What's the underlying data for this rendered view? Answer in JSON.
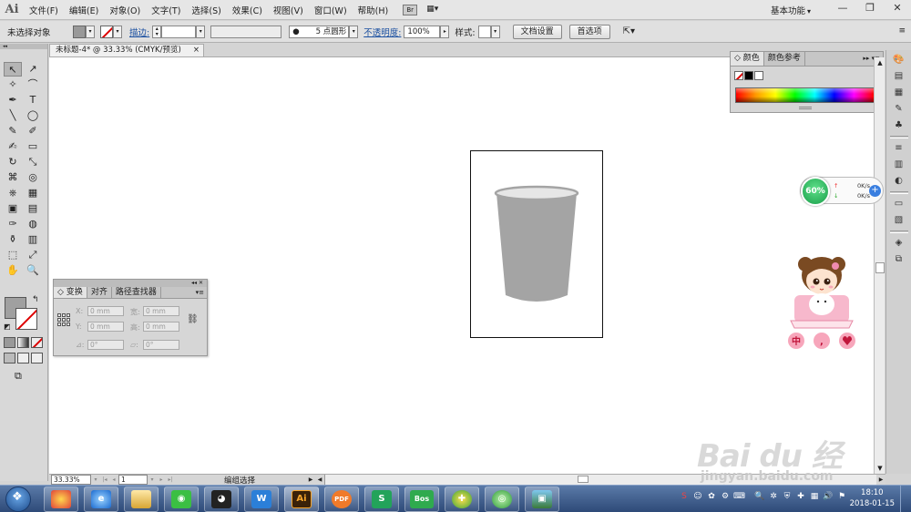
{
  "app": {
    "logo": "Ai",
    "workspace": "基本功能",
    "window_controls": [
      "—",
      "❐",
      "✕"
    ]
  },
  "menu": [
    "文件(F)",
    "编辑(E)",
    "对象(O)",
    "文字(T)",
    "选择(S)",
    "效果(C)",
    "视图(V)",
    "窗口(W)",
    "帮助(H)"
  ],
  "bridge_label": "Br",
  "control": {
    "selection": "未选择对象",
    "stroke_label": "描边:",
    "brush": "5 点圆形",
    "opacity_label": "不透明度:",
    "opacity_value": "100%",
    "style_label": "样式:",
    "doc_setup": "文档设置",
    "prefs": "首选项"
  },
  "document": {
    "tab_title": "未标题-4* @ 33.33% (CMYK/预览)",
    "close": "×"
  },
  "tools": [
    "↖",
    "↗",
    "✧",
    "⌒",
    "✒",
    "T",
    "╲",
    "◯",
    "✎",
    "✐",
    "✍",
    "▭",
    "↻",
    "⤡",
    "⌘",
    "◎",
    "⎈",
    "▦",
    "▣",
    "▤",
    "✑",
    "◍",
    "⚱",
    "▥",
    "⬚",
    "⤢",
    "✋",
    "🔍"
  ],
  "transform_panel": {
    "tabs": [
      "变换",
      "对齐",
      "路径查找器"
    ],
    "x_label": "X:",
    "x_value": "0 mm",
    "w_label": "宽:",
    "w_value": "0 mm",
    "y_label": "Y:",
    "y_value": "0 mm",
    "h_label": "高:",
    "h_value": "0 mm",
    "rotate_label": "⊿:",
    "rotate_value": "0°",
    "shear_label": "▱:",
    "shear_value": "0°"
  },
  "color_panel": {
    "tabs": [
      "颜色",
      "颜色参考"
    ],
    "swatches": [
      "none",
      "#000000",
      "#ffffff"
    ]
  },
  "cup": {
    "body_color": "#a4a4a4",
    "rim_color": "#e6e6e6"
  },
  "net_widget": {
    "percent": "60%",
    "up": "0K/s",
    "down": "0K/s",
    "up_arrow": "↑",
    "down_arrow": "↓"
  },
  "status": {
    "zoom": "33.33%",
    "page": "1",
    "text": "编组选择"
  },
  "taskbar": {
    "apps": [
      "W",
      "Ai",
      "PDF",
      "S",
      "Bos",
      "✚",
      "◎",
      "▣"
    ],
    "active_app": "Ai",
    "time": "18:10",
    "date": "2018-01-15"
  },
  "watermark": {
    "logo": "Bai du 经验",
    "url": "jingyan.baidu.com"
  }
}
